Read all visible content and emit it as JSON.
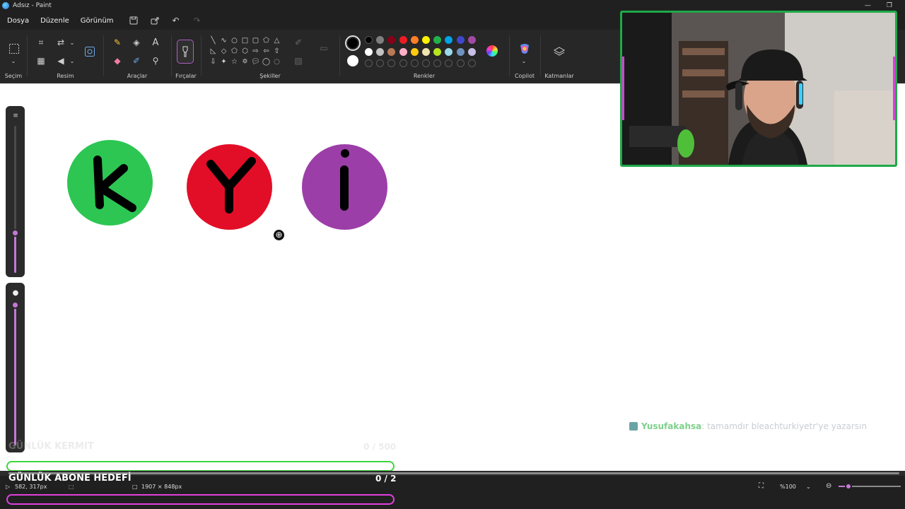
{
  "window": {
    "title": "Adsız - Paint",
    "minimize": "—",
    "restore": "❐"
  },
  "menu": {
    "file": "Dosya",
    "edit": "Düzenle",
    "view": "Görünüm"
  },
  "ribbon": {
    "selection_label": "Seçim",
    "image_label": "Resim",
    "tools_label": "Araçlar",
    "brushes_label": "Fırçalar",
    "shapes_label": "Şekiller",
    "colors_label": "Renkler",
    "copilot_label": "Copilot",
    "layers_label": "Katmanlar",
    "colors": {
      "primary": "#000000",
      "secondary": "#ffffff",
      "row1": [
        "#000000",
        "#7f7f7f",
        "#880015",
        "#ed1c24",
        "#ff7f27",
        "#fff200",
        "#22b14c",
        "#00a2e8",
        "#3f48cc",
        "#a349a4"
      ],
      "row2": [
        "#ffffff",
        "#c3c3c3",
        "#b97a57",
        "#ffaec9",
        "#ffc90e",
        "#efe4b0",
        "#b5e61d",
        "#99d9ea",
        "#7092be",
        "#c8bfe7"
      ]
    }
  },
  "canvas": {
    "circles": [
      {
        "letter": "K",
        "color": "#2dc653"
      },
      {
        "letter": "Y",
        "color": "#e20e27"
      },
      {
        "letter": "İ",
        "color": "#9c3ea8"
      }
    ]
  },
  "chat": {
    "user": "Yusufakahsa",
    "message": ": tamamdır bleachturkiyetr'ye yazarsın"
  },
  "overlay": {
    "goal1": {
      "title": "GÜNLÜK KERMIT",
      "count": "0 / 500",
      "color": "#3dd63d"
    },
    "goal2": {
      "title": "GÜNLÜK ABONE HEDEFİ",
      "count": "0 / 2",
      "color": "#e040e0"
    }
  },
  "status": {
    "cursor_pos": "582, 317px",
    "canvas_size": "1907 × 848px",
    "zoom": "%100"
  }
}
